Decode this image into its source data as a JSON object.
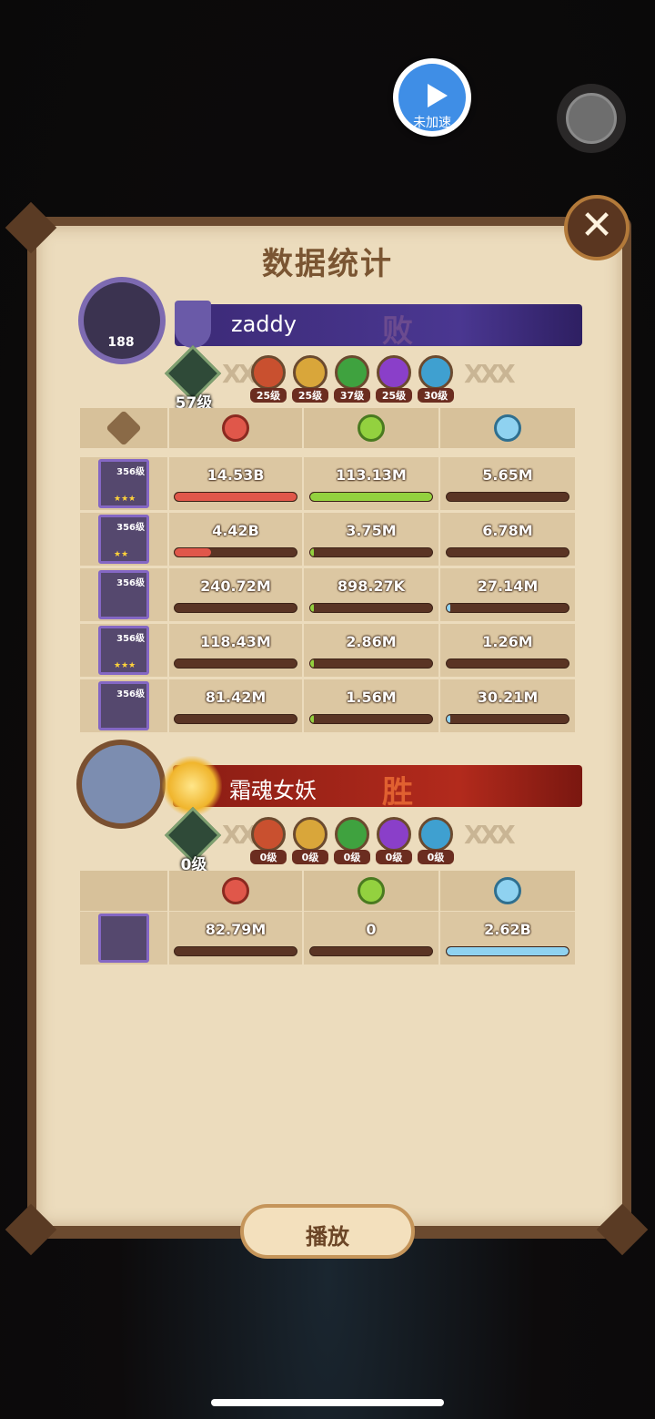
{
  "speed_button": {
    "label": "未加速"
  },
  "panel": {
    "title": "数据统计",
    "close_label": "✕",
    "play_label": "播放"
  },
  "colors": {
    "damage": "#e0574a",
    "heal": "#93d13f",
    "tank": "#8fd2f0"
  },
  "team1": {
    "avatar_level": "188",
    "name": "zaddy",
    "result": "败",
    "tree_level": "57级",
    "factions": [
      {
        "icon": "lightbearer-icon",
        "level": "25级",
        "color": "#c9502f"
      },
      {
        "icon": "mauler-icon",
        "level": "25级",
        "color": "#d9a63a"
      },
      {
        "icon": "wilder-icon",
        "level": "37级",
        "color": "#3fa23f"
      },
      {
        "icon": "graveborn-icon",
        "level": "25级",
        "color": "#8a3fc9"
      },
      {
        "icon": "celestial-icon",
        "level": "30级",
        "color": "#3fa0d0"
      }
    ],
    "rows": [
      {
        "hero_level": "356级",
        "stars": "★★★",
        "damage": "14.53B",
        "heal": "113.13M",
        "tank": "5.65M",
        "damage_frac": 1.0,
        "heal_frac": 1.0,
        "tank_frac": 0.0
      },
      {
        "hero_level": "356级",
        "stars": "★★",
        "damage": "4.42B",
        "heal": "3.75M",
        "tank": "6.78M",
        "damage_frac": 0.3,
        "heal_frac": 0.03,
        "tank_frac": 0.0
      },
      {
        "hero_level": "356级",
        "stars": "",
        "damage": "240.72M",
        "heal": "898.27K",
        "tank": "27.14M",
        "damage_frac": 0.0,
        "heal_frac": 0.01,
        "tank_frac": 0.01
      },
      {
        "hero_level": "356级",
        "stars": "★★★",
        "damage": "118.43M",
        "heal": "2.86M",
        "tank": "1.26M",
        "damage_frac": 0.0,
        "heal_frac": 0.03,
        "tank_frac": 0.0
      },
      {
        "hero_level": "356级",
        "stars": "",
        "damage": "81.42M",
        "heal": "1.56M",
        "tank": "30.21M",
        "damage_frac": 0.0,
        "heal_frac": 0.01,
        "tank_frac": 0.01
      }
    ]
  },
  "team2": {
    "name": "霜魂女妖",
    "result": "胜",
    "tree_level": "0级",
    "factions": [
      {
        "icon": "lightbearer-icon",
        "level": "0级",
        "color": "#c9502f"
      },
      {
        "icon": "mauler-icon",
        "level": "0级",
        "color": "#d9a63a"
      },
      {
        "icon": "wilder-icon",
        "level": "0级",
        "color": "#3fa23f"
      },
      {
        "icon": "graveborn-icon",
        "level": "0级",
        "color": "#8a3fc9"
      },
      {
        "icon": "celestial-icon",
        "level": "0级",
        "color": "#3fa0d0"
      }
    ],
    "rows": [
      {
        "damage": "82.79M",
        "heal": "0",
        "tank": "2.62B",
        "damage_frac": 0.0,
        "heal_frac": 0.0,
        "tank_frac": 1.0
      }
    ]
  }
}
